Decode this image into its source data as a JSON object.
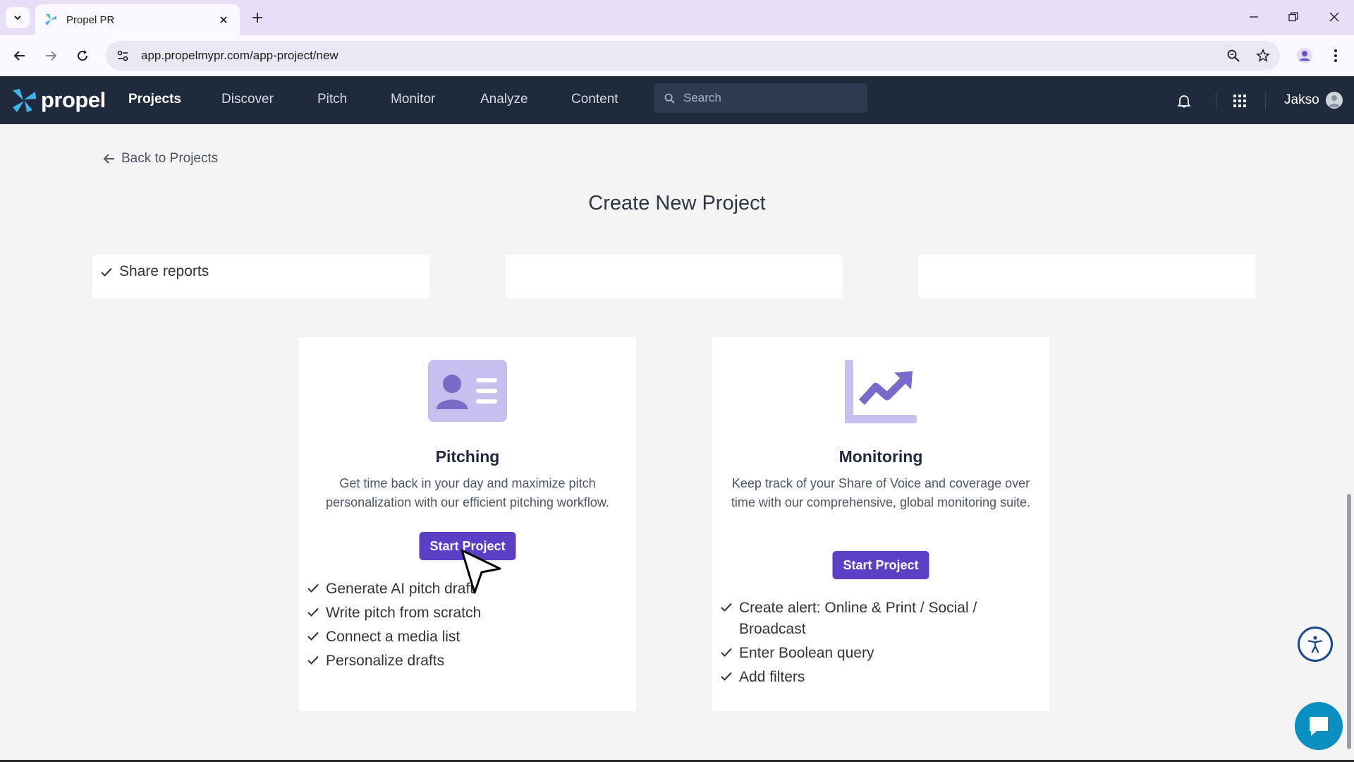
{
  "browser": {
    "tab_title": "Propel PR",
    "url": "app.propelmypr.com/app-project/new"
  },
  "app": {
    "logo_text": "propel",
    "nav": [
      "Projects",
      "Discover",
      "Pitch",
      "Monitor",
      "Analyze",
      "Content"
    ],
    "active_nav": "Projects",
    "search_placeholder": "Search",
    "user_name": "Jakso"
  },
  "page": {
    "back_link": "Back to Projects",
    "title": "Create New Project",
    "top_card_item": "Share reports"
  },
  "cards": {
    "pitching": {
      "title": "Pitching",
      "description": "Get time back in your day and maximize pitch personalization with our efficient pitching workflow.",
      "button": "Start Project",
      "features": [
        "Generate AI pitch draft",
        "Write pitch from scratch",
        "Connect a media list",
        "Personalize drafts"
      ]
    },
    "monitoring": {
      "title": "Monitoring",
      "description": "Keep track of your Share of Voice and coverage over time with our comprehensive, global monitoring suite.",
      "button": "Start Project",
      "features": [
        "Create alert: Online & Print / Social / Broadcast",
        "Enter Boolean query",
        "Add filters"
      ]
    }
  },
  "colors": {
    "nav_bg": "#1f2a3c",
    "accent": "#5b3fc4",
    "icon_tint": "#c9bfee",
    "page_bg": "#f4f4f5"
  }
}
